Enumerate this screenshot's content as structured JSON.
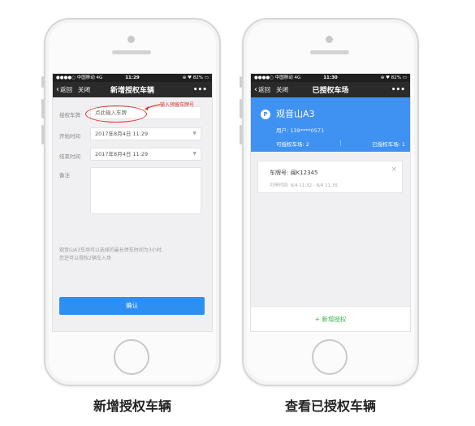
{
  "statusbar": {
    "left": {
      "carrier": "●●●●○ 中国移动  4G",
      "time": "11:29",
      "right": "⊕ ♥ 82% ▭"
    },
    "right": {
      "carrier": "●●●●○ 中国移动  4G",
      "time": "11:30",
      "right": "⊕ ♥ 82% ▭"
    }
  },
  "nav": {
    "back_label": "返回",
    "close_label": "关闭",
    "more_icon": "•••",
    "left_title": "新增授权车辆",
    "right_title": "已授权车场"
  },
  "form": {
    "plate_label": "授权车牌",
    "plate_placeholder": "点此输入车牌",
    "annotation": "输入预留车牌号",
    "start_label": "开始时间",
    "start_value": "2017年8月4日  11:29",
    "end_label": "结束时间",
    "end_value": "2017年8月4日  11:29",
    "notes_label": "备注",
    "notes_value": "",
    "info_line1": "观音山A3车场可以选择的最长停车时间为3小时,",
    "info_line2": "您还可以授权2辆车入场",
    "confirm_label": "确认"
  },
  "lot": {
    "icon_glyph": "P",
    "name": "观音山A3",
    "user": "用户: 139****0571",
    "authorizable": "可授权车场: 2",
    "separator": "|",
    "authorized": "已授权车场: 1"
  },
  "card": {
    "plate": "车牌号: 闽K12345",
    "time": "可停时间: 8/4 11:32 - 8/4 11:35",
    "close_icon": "×"
  },
  "add_auth_label": "+ 新增授权",
  "captions": {
    "left": "新增授权车辆",
    "right": "查看已授权车辆"
  },
  "colors": {
    "accent_blue": "#2e8ff3",
    "header_blue": "#3f91f2",
    "annotation_red": "#e53030",
    "add_green": "#3bb24b",
    "navbar_dark": "#2a2a2a"
  }
}
